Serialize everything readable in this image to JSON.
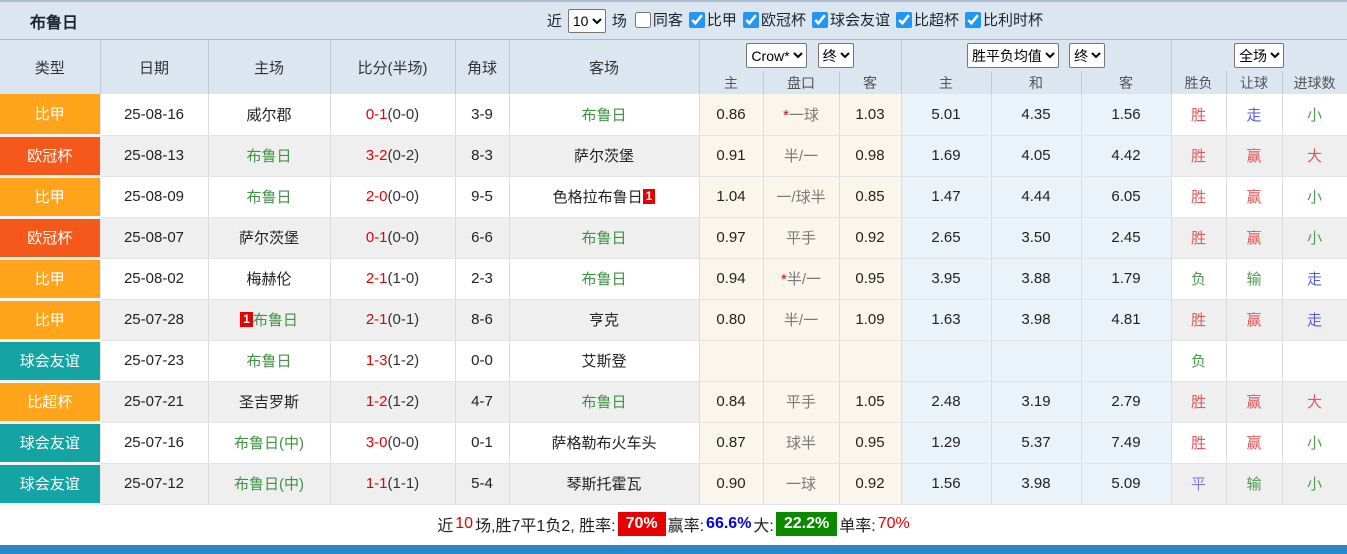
{
  "topbar": {
    "team": "布鲁日",
    "near_label": "近",
    "games_count": "10",
    "games_label": "场",
    "filters": [
      {
        "label": "同客",
        "checked": false
      },
      {
        "label": "比甲",
        "checked": true
      },
      {
        "label": "欧冠杯",
        "checked": true
      },
      {
        "label": "球会友谊",
        "checked": true
      },
      {
        "label": "比超杯",
        "checked": true
      },
      {
        "label": "比利时杯",
        "checked": true
      }
    ]
  },
  "table": {
    "col_headers": [
      "类型",
      "日期",
      "主场",
      "比分(半场)",
      "角球",
      "客场"
    ],
    "sub_headers": [
      "主",
      "盘口",
      "客",
      "主",
      "和",
      "客",
      "胜负",
      "让球",
      "进球数"
    ],
    "groups": {
      "crow": {
        "main": "Crow*",
        "final": "终"
      },
      "avg": {
        "main": "胜平负均值",
        "final": "终"
      },
      "period": {
        "main": "全场"
      }
    },
    "rows": [
      {
        "type": "比甲",
        "type_color": "orange",
        "date": "25-08-16",
        "home": {
          "name": "威尔郡",
          "green": false,
          "badge": "",
          "badge_pos": ""
        },
        "score": "0-1",
        "half": "(0-0)",
        "corner": "3-9",
        "away": {
          "name": "布鲁日",
          "green": true,
          "badge": "",
          "badge_pos": ""
        },
        "crow": {
          "home": "0.86",
          "star": true,
          "handicap": "一球",
          "away": "1.03"
        },
        "avg": {
          "home": "5.01",
          "draw": "4.35",
          "away": "1.56"
        },
        "results": [
          [
            "胜",
            "red"
          ],
          [
            "走",
            "blue"
          ],
          [
            "小",
            "green"
          ]
        ]
      },
      {
        "type": "欧冠杯",
        "type_color": "deep",
        "date": "25-08-13",
        "home": {
          "name": "布鲁日",
          "green": true,
          "badge": "",
          "badge_pos": ""
        },
        "score": "3-2",
        "half": "(0-2)",
        "corner": "8-3",
        "away": {
          "name": "萨尔茨堡",
          "green": false,
          "badge": "",
          "badge_pos": ""
        },
        "crow": {
          "home": "0.91",
          "star": false,
          "handicap": "半/一",
          "away": "0.98"
        },
        "avg": {
          "home": "1.69",
          "draw": "4.05",
          "away": "4.42"
        },
        "results": [
          [
            "胜",
            "red"
          ],
          [
            "赢",
            "red"
          ],
          [
            "大",
            "red"
          ]
        ]
      },
      {
        "type": "比甲",
        "type_color": "orange",
        "date": "25-08-09",
        "home": {
          "name": "布鲁日",
          "green": true,
          "badge": "",
          "badge_pos": ""
        },
        "score": "2-0",
        "half": "(0-0)",
        "corner": "9-5",
        "away": {
          "name": "色格拉布鲁日",
          "green": false,
          "badge": "1",
          "badge_pos": "post"
        },
        "crow": {
          "home": "1.04",
          "star": false,
          "handicap": "一/球半",
          "away": "0.85"
        },
        "avg": {
          "home": "1.47",
          "draw": "4.44",
          "away": "6.05"
        },
        "results": [
          [
            "胜",
            "red"
          ],
          [
            "赢",
            "red"
          ],
          [
            "小",
            "green"
          ]
        ]
      },
      {
        "type": "欧冠杯",
        "type_color": "deep",
        "date": "25-08-07",
        "home": {
          "name": "萨尔茨堡",
          "green": false,
          "badge": "",
          "badge_pos": ""
        },
        "score": "0-1",
        "half": "(0-0)",
        "corner": "6-6",
        "away": {
          "name": "布鲁日",
          "green": true,
          "badge": "",
          "badge_pos": ""
        },
        "crow": {
          "home": "0.97",
          "star": false,
          "handicap": "平手",
          "away": "0.92"
        },
        "avg": {
          "home": "2.65",
          "draw": "3.50",
          "away": "2.45"
        },
        "results": [
          [
            "胜",
            "red"
          ],
          [
            "赢",
            "red"
          ],
          [
            "小",
            "green"
          ]
        ]
      },
      {
        "type": "比甲",
        "type_color": "orange",
        "date": "25-08-02",
        "home": {
          "name": "梅赫伦",
          "green": false,
          "badge": "",
          "badge_pos": ""
        },
        "score": "2-1",
        "half": "(1-0)",
        "corner": "2-3",
        "away": {
          "name": "布鲁日",
          "green": true,
          "badge": "",
          "badge_pos": ""
        },
        "crow": {
          "home": "0.94",
          "star": true,
          "handicap": "半/一",
          "away": "0.95"
        },
        "avg": {
          "home": "3.95",
          "draw": "3.88",
          "away": "1.79"
        },
        "results": [
          [
            "负",
            "green"
          ],
          [
            "输",
            "green"
          ],
          [
            "走",
            "blue"
          ]
        ]
      },
      {
        "type": "比甲",
        "type_color": "orange",
        "date": "25-07-28",
        "home": {
          "name": "布鲁日",
          "green": true,
          "badge": "1",
          "badge_pos": "pre"
        },
        "score": "2-1",
        "half": "(0-1)",
        "corner": "8-6",
        "away": {
          "name": "亨克",
          "green": false,
          "badge": "",
          "badge_pos": ""
        },
        "crow": {
          "home": "0.80",
          "star": false,
          "handicap": "半/一",
          "away": "1.09"
        },
        "avg": {
          "home": "1.63",
          "draw": "3.98",
          "away": "4.81"
        },
        "results": [
          [
            "胜",
            "red"
          ],
          [
            "赢",
            "red"
          ],
          [
            "走",
            "blue"
          ]
        ]
      },
      {
        "type": "球会友谊",
        "type_color": "teal",
        "date": "25-07-23",
        "home": {
          "name": "布鲁日",
          "green": true,
          "badge": "",
          "badge_pos": ""
        },
        "score": "1-3",
        "half": "(1-2)",
        "corner": "0-0",
        "away": {
          "name": "艾斯登",
          "green": false,
          "badge": "",
          "badge_pos": ""
        },
        "crow": {
          "home": "",
          "star": false,
          "handicap": "",
          "away": ""
        },
        "avg": {
          "home": "",
          "draw": "",
          "away": ""
        },
        "results": [
          [
            "负",
            "green"
          ],
          [
            "",
            ""
          ],
          [
            "",
            ""
          ]
        ]
      },
      {
        "type": "比超杯",
        "type_color": "orange",
        "date": "25-07-21",
        "home": {
          "name": "圣吉罗斯",
          "green": false,
          "badge": "",
          "badge_pos": ""
        },
        "score": "1-2",
        "half": "(1-2)",
        "corner": "4-7",
        "away": {
          "name": "布鲁日",
          "green": true,
          "badge": "",
          "badge_pos": ""
        },
        "crow": {
          "home": "0.84",
          "star": false,
          "handicap": "平手",
          "away": "1.05"
        },
        "avg": {
          "home": "2.48",
          "draw": "3.19",
          "away": "2.79"
        },
        "results": [
          [
            "胜",
            "red"
          ],
          [
            "赢",
            "red"
          ],
          [
            "大",
            "red"
          ]
        ]
      },
      {
        "type": "球会友谊",
        "type_color": "teal",
        "date": "25-07-16",
        "home": {
          "name": "布鲁日(中)",
          "green": true,
          "badge": "",
          "badge_pos": ""
        },
        "score": "3-0",
        "half": "(0-0)",
        "corner": "0-1",
        "away": {
          "name": "萨格勒布火车头",
          "green": false,
          "badge": "",
          "badge_pos": ""
        },
        "crow": {
          "home": "0.87",
          "star": false,
          "handicap": "球半",
          "away": "0.95"
        },
        "avg": {
          "home": "1.29",
          "draw": "5.37",
          "away": "7.49"
        },
        "results": [
          [
            "胜",
            "red"
          ],
          [
            "赢",
            "red"
          ],
          [
            "小",
            "green"
          ]
        ]
      },
      {
        "type": "球会友谊",
        "type_color": "teal",
        "date": "25-07-12",
        "home": {
          "name": "布鲁日(中)",
          "green": true,
          "badge": "",
          "badge_pos": ""
        },
        "score": "1-1",
        "half": "(1-1)",
        "corner": "5-4",
        "away": {
          "name": "琴斯托霍瓦",
          "green": false,
          "badge": "",
          "badge_pos": ""
        },
        "crow": {
          "home": "0.90",
          "star": false,
          "handicap": "一球",
          "away": "0.92"
        },
        "avg": {
          "home": "1.56",
          "draw": "3.98",
          "away": "5.09"
        },
        "results": [
          [
            "平",
            "violet"
          ],
          [
            "输",
            "green"
          ],
          [
            "小",
            "green"
          ]
        ]
      }
    ]
  },
  "summary": {
    "segments": [
      {
        "text": "近",
        "style": "plain"
      },
      {
        "text": "10",
        "style": "red"
      },
      {
        "text": "场,胜7平1负2, 胜率:",
        "style": "plain"
      },
      {
        "text": "70%",
        "style": "badge-red"
      },
      {
        "text": "赢率:",
        "style": "plain"
      },
      {
        "text": "66.6%",
        "style": "blue"
      },
      {
        "text": " 大:",
        "style": "plain"
      },
      {
        "text": "22.2%",
        "style": "badge-green"
      },
      {
        "text": "单率:",
        "style": "plain"
      },
      {
        "text": "70%",
        "style": "red"
      }
    ]
  },
  "colors": {
    "league_orange": "#ffa41b",
    "cup_deep_orange": "#f4581b",
    "friendly_teal": "#14a4a4",
    "score_red": "#e60000",
    "team_green": "#3f9342",
    "result_red": "#e25757",
    "result_green": "#4e9b51",
    "result_blue": "#5a5ae6",
    "rate_blue": "#0000e6",
    "badge_red_bg": "#e60000",
    "badge_green_bg": "#0b8a00",
    "header_bg": "#dce6f1",
    "crow_col_bg": "#fbf6ec",
    "avg_col_bg": "#e9f3f9",
    "bottom_bar_blue": "#2b87c6"
  }
}
